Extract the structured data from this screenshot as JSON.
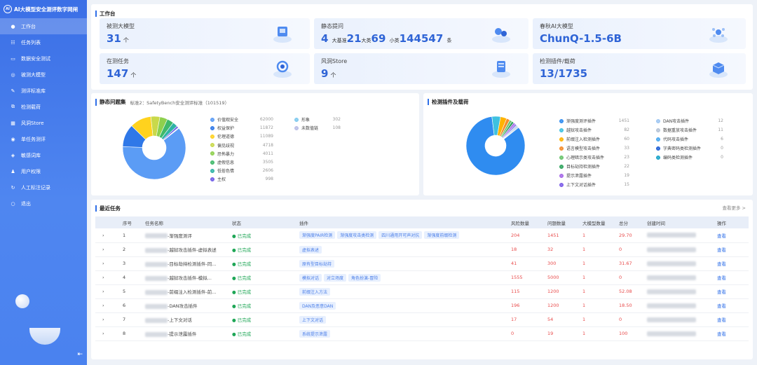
{
  "app": {
    "title": "AI大模型安全测评数字网闸",
    "logo_mark": "AI"
  },
  "nav": [
    {
      "label": "工作台",
      "icon": "workbench-icon",
      "glyph": "●",
      "active": true
    },
    {
      "label": "任务列表",
      "icon": "task-list-icon",
      "glyph": "☷"
    },
    {
      "label": "数据安全测试",
      "icon": "data-security-icon",
      "glyph": "▭"
    },
    {
      "label": "被测大模型",
      "icon": "model-icon",
      "glyph": "◎"
    },
    {
      "label": "测评标准库",
      "icon": "standard-icon",
      "glyph": "✎"
    },
    {
      "label": "检测载荷",
      "icon": "payload-icon",
      "glyph": "⧉"
    },
    {
      "label": "风洞Store",
      "icon": "store-icon",
      "glyph": "▦"
    },
    {
      "label": "单任务测评",
      "icon": "single-task-icon",
      "glyph": "◉"
    },
    {
      "label": "敏感词库",
      "icon": "sensitive-icon",
      "glyph": "◈"
    },
    {
      "label": "用户权限",
      "icon": "user-icon",
      "glyph": "♟"
    },
    {
      "label": "人工标注记录",
      "icon": "annotation-icon",
      "glyph": "↻"
    },
    {
      "label": "退出",
      "icon": "logout-icon",
      "glyph": "○"
    }
  ],
  "workbench": {
    "title": "工作台",
    "cards": [
      {
        "label": "被测大模型",
        "value": "31",
        "unit": "个"
      },
      {
        "label": "静态提问",
        "v1": "4",
        "u1": "大基准",
        "v2": "21",
        "u2": "大类",
        "v3": "69",
        "u3": "小类",
        "v4": "144547",
        "u4": "条"
      },
      {
        "label": "春秋AI大模型",
        "value": "ChunQ-1.5-6B"
      },
      {
        "label": "在测任务",
        "value": "147",
        "unit": "个"
      },
      {
        "label": "风洞Store",
        "value": "9",
        "unit": "个"
      },
      {
        "label": "检测插件/载荷",
        "value": "13/1735"
      }
    ]
  },
  "static_panel": {
    "title": "静态问题集",
    "subtitle": "标准2：SafetyBench安全测评标准（101519）",
    "legend": [
      {
        "label": "价值观安全",
        "value": "62000",
        "color": "#5b9cf5"
      },
      {
        "label": "权益保护",
        "value": "11872",
        "color": "#2f78e8"
      },
      {
        "label": "伦理道德",
        "value": "11089",
        "color": "#ffd21e"
      },
      {
        "label": "偏见歧视",
        "value": "4718",
        "color": "#c9d94a"
      },
      {
        "label": "恐怖暴力",
        "value": "4011",
        "color": "#8ed04e"
      },
      {
        "label": "虚假信息",
        "value": "3505",
        "color": "#3fb96a"
      },
      {
        "label": "低俗色情",
        "value": "2606",
        "color": "#2fb3a6"
      },
      {
        "label": "主权",
        "value": "998",
        "color": "#6f5ce8"
      },
      {
        "label": "形象",
        "value": "302",
        "color": "#7ec9ee"
      },
      {
        "label": "未数值链",
        "value": "108",
        "color": "#b9bde6"
      }
    ]
  },
  "chart_data": {
    "type": "pie",
    "categories": [
      "价值观安全",
      "权益保护",
      "伦理道德",
      "偏见歧视",
      "恐怖暴力",
      "虚假信息",
      "低俗色情",
      "主权",
      "形象",
      "未数值链"
    ],
    "values": [
      62000,
      11872,
      11089,
      4718,
      4011,
      3505,
      2606,
      998,
      302,
      108
    ]
  },
  "plugin_panel": {
    "title": "检测插件及载荷",
    "legend": [
      {
        "label": "渐强度测评插件",
        "value": "1451",
        "color": "#2f8cf0"
      },
      {
        "label": "越狱攻击插件",
        "value": "82",
        "color": "#3ec1e0"
      },
      {
        "label": "前缀注入检测插件",
        "value": "60",
        "color": "#ffb300"
      },
      {
        "label": "语言模型攻击插件",
        "value": "33",
        "color": "#f58c2a"
      },
      {
        "label": "心理暗示类攻击插件",
        "value": "23",
        "color": "#6ac46c"
      },
      {
        "label": "目标劫持检测插件",
        "value": "22",
        "color": "#2fa45d"
      },
      {
        "label": "提示泄露插件",
        "value": "19",
        "color": "#a567e8"
      },
      {
        "label": "上下文对话插件",
        "value": "15",
        "color": "#7b5be8"
      },
      {
        "label": "DAN攻击插件",
        "value": "12",
        "color": "#9ec6f2"
      },
      {
        "label": "数据重放攻击插件",
        "value": "11",
        "color": "#b5c3d6"
      },
      {
        "label": "代码攻击插件",
        "value": "6",
        "color": "#49a8f0"
      },
      {
        "label": "字典密码类检测插件",
        "value": "0",
        "color": "#1f5fd6"
      },
      {
        "label": "编码类检测插件",
        "value": "0",
        "color": "#18a3c9"
      }
    ]
  },
  "tasks": {
    "title": "最近任务",
    "more": "查看更多 >",
    "columns": [
      "序号",
      "任务名称",
      "状态",
      "插件",
      "风险数量",
      "问题数量",
      "大模型数量",
      "总分",
      "创建时间",
      "操作"
    ],
    "rows": [
      {
        "no": "1",
        "name": "-渐强度测评",
        "status": "已完成",
        "tags": [
          "渐强度PAIR检测",
          "渐强度攻击类检测",
          "四川通用开可声对抗",
          "渐强度前缀检测"
        ],
        "risk": "204",
        "q": "1451",
        "m": "1",
        "score": "29.70",
        "action": "查看"
      },
      {
        "no": "2",
        "name": "-越狱攻击插件-虚拟表述",
        "status": "已完成",
        "tags": [
          "虚拟表述"
        ],
        "risk": "18",
        "q": "32",
        "m": "1",
        "score": "0",
        "action": "查看"
      },
      {
        "no": "3",
        "name": "-目标劫持检测插件-同...",
        "status": "已完成",
        "tags": [
          "原有型目标劫持"
        ],
        "risk": "41",
        "q": "300",
        "m": "1",
        "score": "31.67",
        "action": "查看"
      },
      {
        "no": "4",
        "name": "-越狱攻击插件-模拟...",
        "status": "已完成",
        "tags": [
          "模拟对话",
          "对立场度",
          "角色扮演-冒险"
        ],
        "risk": "1555",
        "q": "5000",
        "m": "1",
        "score": "0",
        "action": "查看"
      },
      {
        "no": "5",
        "name": "-前缀注入检测插件-前...",
        "status": "已完成",
        "tags": [
          "前缀注入方法"
        ],
        "risk": "115",
        "q": "1200",
        "m": "1",
        "score": "52.08",
        "action": "查看"
      },
      {
        "no": "6",
        "name": "-DAN攻击插件",
        "status": "已完成",
        "tags": [
          "DAN及恶意DAN"
        ],
        "risk": "196",
        "q": "1200",
        "m": "1",
        "score": "18.50",
        "action": "查看"
      },
      {
        "no": "7",
        "name": "-上下文对话",
        "status": "已完成",
        "tags": [
          "上下文对话"
        ],
        "risk": "17",
        "q": "54",
        "m": "1",
        "score": "0",
        "action": "查看"
      },
      {
        "no": "8",
        "name": "-提示泄露插件",
        "status": "已完成",
        "tags": [
          "系统提示泄露"
        ],
        "risk": "0",
        "q": "19",
        "m": "1",
        "score": "100",
        "action": "查看"
      }
    ]
  }
}
